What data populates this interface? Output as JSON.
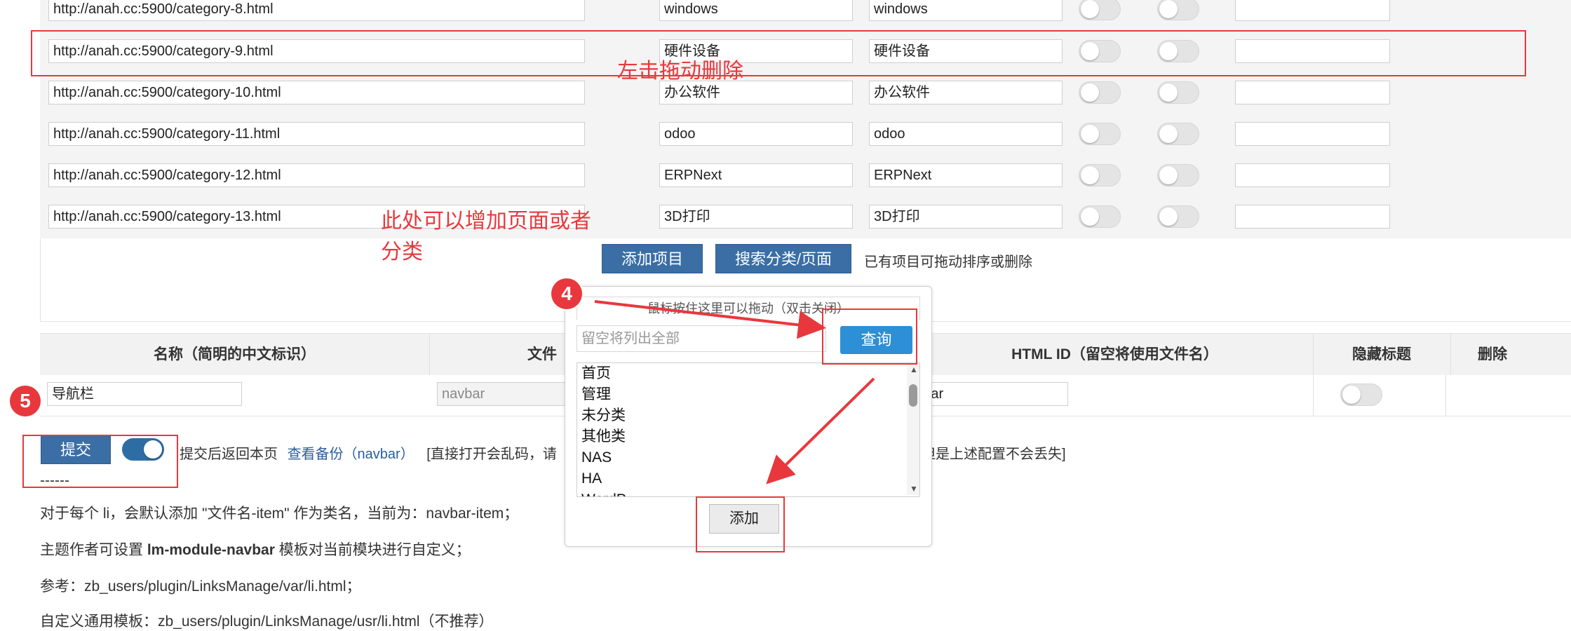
{
  "rows": [
    {
      "url": "http://anah.cc:5900/category-8.html",
      "name": "windows",
      "title": "windows"
    },
    {
      "url": "http://anah.cc:5900/category-9.html",
      "name": "硬件设备",
      "title": "硬件设备"
    },
    {
      "url": "http://anah.cc:5900/category-10.html",
      "name": "办公软件",
      "title": "办公软件"
    },
    {
      "url": "http://anah.cc:5900/category-11.html",
      "name": "odoo",
      "title": "odoo"
    },
    {
      "url": "http://anah.cc:5900/category-12.html",
      "name": "ERPNext",
      "title": "ERPNext"
    },
    {
      "url": "http://anah.cc:5900/category-13.html",
      "name": "3D打印",
      "title": "3D打印"
    }
  ],
  "actions": {
    "add_item": "添加项目",
    "search": "搜索分类/页面",
    "hint": "已有项目可拖动排序或删除"
  },
  "annotations": {
    "drag_delete": "左击拖动删除",
    "add_hint_line1": "此处可以增加页面或者",
    "add_hint_line2": "分类",
    "badge4": "4",
    "badge5": "5"
  },
  "table": {
    "headers": [
      "名称（简明的中文标识）",
      "文件",
      "HTML ID（留空将使用文件名）",
      "隐藏标题",
      "删除"
    ],
    "name_value": "导航栏",
    "file_value": "navbar",
    "html_id_value": "Bar"
  },
  "popup": {
    "drag_hint": "鼠标按住这里可以拖动（双击关闭）",
    "query_placeholder": "留空将列出全部",
    "query_button": "查询",
    "items": [
      "首页",
      "管理",
      "未分类",
      "其他类",
      "NAS",
      "HA",
      "WordP"
    ],
    "add_button": "添加"
  },
  "submit": {
    "button": "提交",
    "after_text": "提交后返回本页",
    "backup_link": "查看备份（navbar）",
    "direct_open": "[直接打开会乱码，请",
    "tail": "但是上述配置不会丢失]"
  },
  "footer": {
    "dashes": "------",
    "line1": "对于每个 li，会默认添加 \"文件名-item\" 作为类名，当前为：navbar-item；",
    "line2_a": "主题作者可设置 ",
    "line2_b": "lm-module-navbar",
    "line2_c": " 模板对当前模块进行自定义；",
    "line3": "参考：zb_users/plugin/LinksManage/var/li.html；",
    "line4": "自定义通用模板：zb_users/plugin/LinksManage/usr/li.html（不推荐）"
  },
  "colors": {
    "accent_blue": "#3a6ea5",
    "annotation_red": "#e8383d",
    "query_blue": "#2d8fd5"
  }
}
